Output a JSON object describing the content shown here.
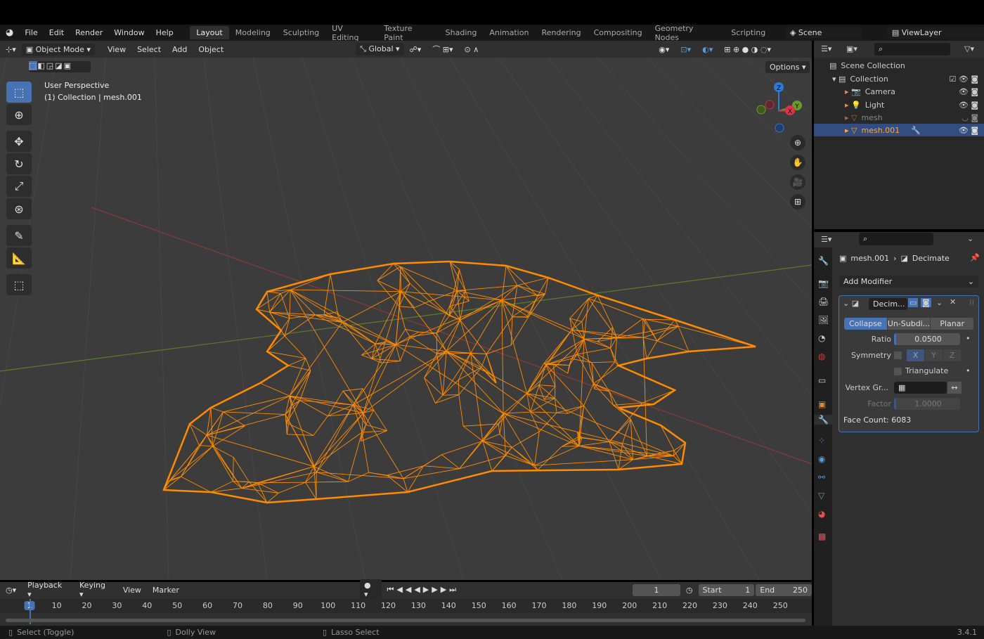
{
  "menu": [
    "File",
    "Edit",
    "Render",
    "Window",
    "Help"
  ],
  "workspaces": [
    "Layout",
    "Modeling",
    "Sculpting",
    "UV Editing",
    "Texture Paint",
    "Shading",
    "Animation",
    "Rendering",
    "Compositing",
    "Geometry Nodes",
    "Scripting"
  ],
  "active_workspace": "Layout",
  "scene": "Scene",
  "view_layer": "ViewLayer",
  "viewport_header": {
    "mode": "Object Mode",
    "menus": [
      "View",
      "Select",
      "Add",
      "Object"
    ],
    "orientation": "Global",
    "options": "Options"
  },
  "viewport": {
    "perspective": "User Perspective",
    "context": "(1) Collection | mesh.001",
    "mesh_color": "#ff8c00"
  },
  "gizmo": {
    "z": "Z",
    "y": "Y",
    "x": "X"
  },
  "outliner": {
    "root": "Scene Collection",
    "collection": "Collection",
    "items": [
      {
        "name": "Camera"
      },
      {
        "name": "Light"
      },
      {
        "name": "mesh"
      },
      {
        "name": "mesh.001",
        "selected": true
      }
    ]
  },
  "properties": {
    "object": "mesh.001",
    "modifier": "Decimate",
    "add_modifier": "Add Modifier",
    "modifier_name": "Decim...",
    "tabs": [
      "Collapse",
      "Un-Subdi...",
      "Planar"
    ],
    "active_tab": "Collapse",
    "ratio_label": "Ratio",
    "ratio": "0.0500",
    "symmetry_label": "Symmetry",
    "axes": [
      "X",
      "Y",
      "Z"
    ],
    "triangulate": "Triangulate",
    "vertex_group_label": "Vertex Gr...",
    "factor_label": "Factor",
    "factor": "1.0000",
    "face_count": "Face Count: 6083"
  },
  "timeline": {
    "menus": [
      "Playback",
      "Keying",
      "View",
      "Marker"
    ],
    "current_frame": "1",
    "start_label": "Start",
    "start": "1",
    "end_label": "End",
    "end": "250",
    "ticks": [
      "1",
      "10",
      "20",
      "30",
      "40",
      "50",
      "60",
      "70",
      "80",
      "90",
      "100",
      "110",
      "120",
      "130",
      "140",
      "150",
      "160",
      "170",
      "180",
      "190",
      "200",
      "210",
      "220",
      "230",
      "240",
      "250"
    ]
  },
  "status": {
    "select": "Select (Toggle)",
    "dolly": "Dolly View",
    "lasso": "Lasso Select",
    "version": "3.4.1"
  }
}
